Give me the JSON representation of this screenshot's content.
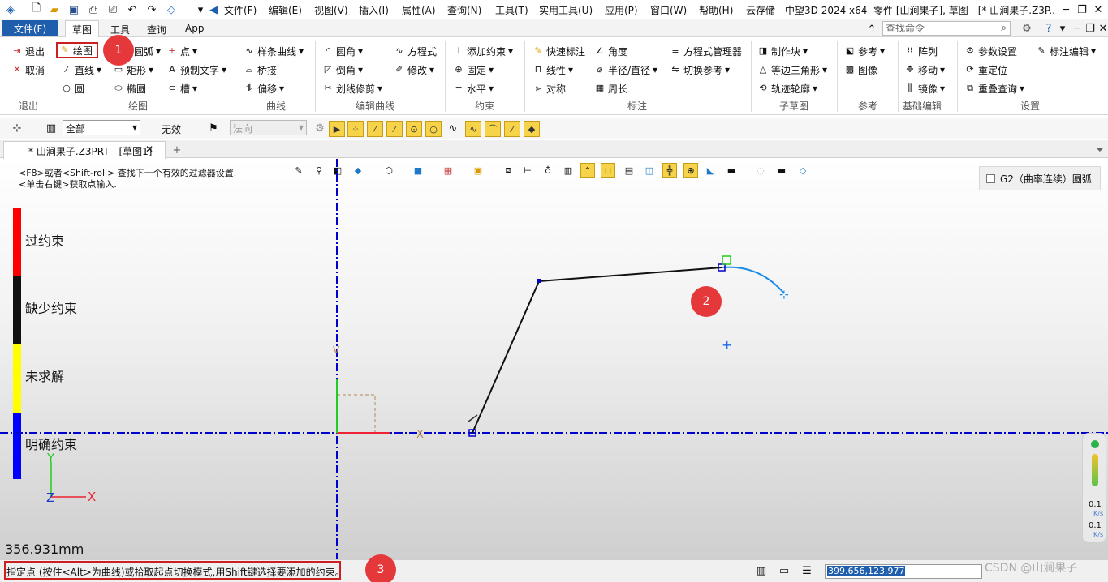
{
  "app": {
    "product": "中望3D 2024 x64",
    "title": "零件 [山涧果子], 草图 - [* 山涧果子.Z3P..."
  },
  "menu": [
    "文件(F)",
    "编辑(E)",
    "视图(V)",
    "插入(I)",
    "属性(A)",
    "查询(N)",
    "工具(T)",
    "实用工具(U)",
    "应用(P)",
    "窗口(W)",
    "帮助(H)",
    "云存储"
  ],
  "ribbon_tabs": [
    "文件(F)",
    "草图",
    "工具",
    "查询",
    "App"
  ],
  "active_tab": "草图",
  "search_placeholder": "查找命令",
  "ribbon": {
    "exit_label": "退出",
    "cancel_label": "取消",
    "exit_group": "退出",
    "draw": "绘图",
    "arc": "圆弧",
    "point": "点",
    "line": "直线",
    "rect": "矩形",
    "preset_text": "预制文字",
    "circle": "圆",
    "ellipse": "椭圆",
    "slot": "槽",
    "draw_group": "绘图",
    "spline": "样条曲线",
    "bridge": "桥接",
    "offset": "偏移",
    "curve_group": "曲线",
    "fillet": "圆角",
    "chamfer": "倒角",
    "trim": "划线修剪",
    "equation": "方程式",
    "modify": "修改",
    "edit_curve_group": "编辑曲线",
    "add_constraint": "添加约束",
    "fix": "固定",
    "horizontal": "水平",
    "constraint_group": "约束",
    "quick_dim": "快速标注",
    "angle": "角度",
    "eq_manager": "方程式管理器",
    "linear": "线性",
    "radius": "半径/直径",
    "toggle_ref": "切换参考",
    "symmetric": "对称",
    "perimeter": "周长",
    "dim_group": "标注",
    "make_block": "制作块",
    "tri": "等边三角形",
    "trace": "轨迹轮廓",
    "subsketch_group": "子草图",
    "reference": "参考",
    "image": "图像",
    "ref_group": "参考",
    "array": "阵列",
    "move": "移动",
    "mirror": "镜像",
    "basic_group": "基础编辑",
    "param": "参数设置",
    "dim_edit": "标注编辑",
    "reposition": "重定位",
    "overlap": "重叠查询",
    "settings_group": "设置"
  },
  "filter_toolbar": {
    "filter_value": "全部",
    "invalid_label": "无效",
    "normal_placeholder": "法向"
  },
  "doc_tab": "* 山涧果子.Z3PRT - [草图1]",
  "hints": [
    "<F8>或者<Shift-roll> 查找下一个有效的过滤器设置.",
    "<单击右键>获取点输入."
  ],
  "constraint_legend": [
    {
      "label": "过约束",
      "color": "#ff0000"
    },
    {
      "label": "缺少约束",
      "color": "#111111"
    },
    {
      "label": "未求解",
      "color": "#ffff00"
    },
    {
      "label": "明确约束",
      "color": "#0000ff"
    }
  ],
  "g2_label": "G2（曲率连续）圆弧",
  "scale_readout": "356.931mm",
  "axis_labels": {
    "x": "X",
    "y": "Y",
    "z": "Z"
  },
  "badges": [
    "1",
    "2",
    "3"
  ],
  "status_prompt": "指定点 (按住<Alt>为曲线)或拾取起点切换模式,用Shift键选择要添加的约束。",
  "coordinates": "399.656,123.977",
  "gauge": {
    "top": "0.1",
    "top_unit": "K/s",
    "bottom": "0.1",
    "bottom_unit": "K/s"
  },
  "watermark": "CSDN @山涧果子",
  "colors": {
    "accent": "#1e5ead",
    "badge": "#e5383b",
    "axis": "#0000cc",
    "curve": "#1a8ae6"
  }
}
